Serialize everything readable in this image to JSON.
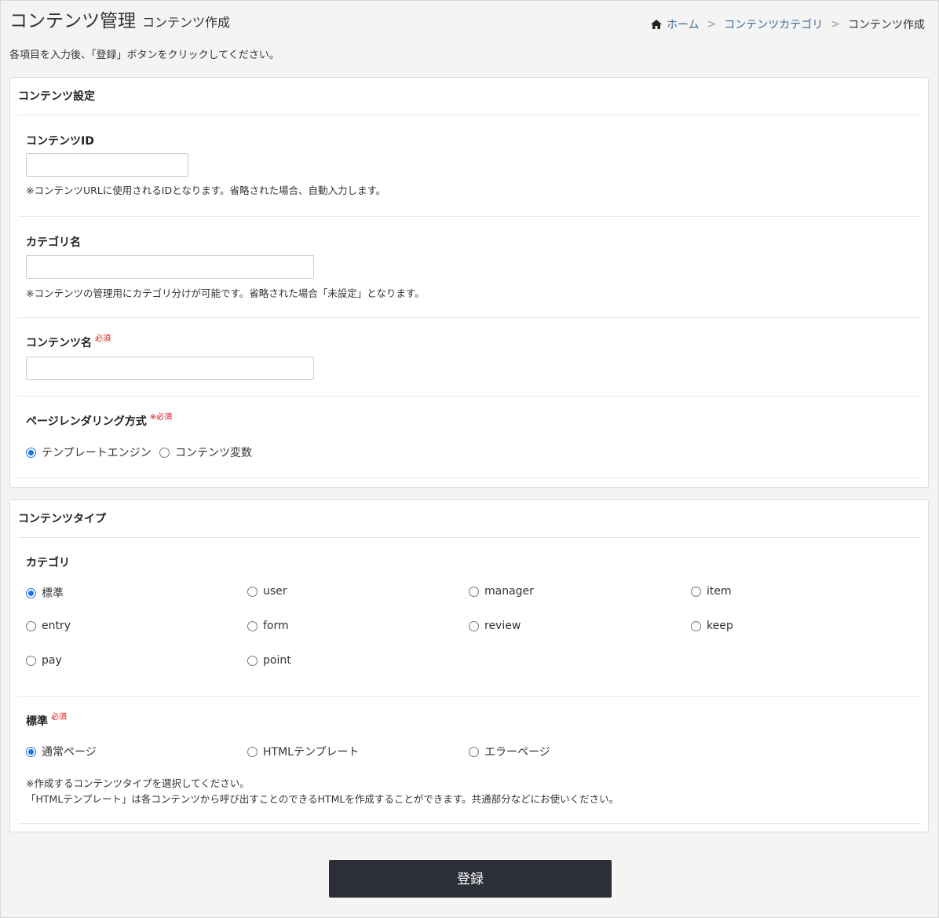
{
  "header": {
    "title": "コンテンツ管理",
    "subtitle": "コンテンツ作成"
  },
  "breadcrumb": {
    "home": "ホーム",
    "sep": ">",
    "category": "コンテンツカテゴリ",
    "current": "コンテンツ作成"
  },
  "intro": "各項目を入力後、「登録」ボタンをクリックしてください。",
  "settings": {
    "heading": "コンテンツ設定",
    "content_id": {
      "label": "コンテンツID",
      "value": "",
      "help": "※コンテンツURLに使用されるIDとなります。省略された場合、自動入力します。"
    },
    "category_name": {
      "label": "カテゴリ名",
      "value": "",
      "help": "※コンテンツの管理用にカテゴリ分けが可能です。省略された場合「未設定」となります。"
    },
    "content_name": {
      "label": "コンテンツ名",
      "required": "必須",
      "value": ""
    },
    "rendering": {
      "label": "ページレンダリング方式",
      "required": "※必須",
      "options": [
        "テンプレートエンジン",
        "コンテンツ変数"
      ],
      "selected": "テンプレートエンジン"
    }
  },
  "type": {
    "heading": "コンテンツタイプ",
    "category": {
      "label": "カテゴリ",
      "options": [
        "標準",
        "user",
        "manager",
        "item",
        "entry",
        "form",
        "review",
        "keep",
        "pay",
        "point"
      ],
      "selected": "標準"
    },
    "standard": {
      "label": "標準",
      "required": "必須",
      "options": [
        "通常ページ",
        "HTMLテンプレート",
        "エラーページ"
      ],
      "selected": "通常ページ",
      "help1": "※作成するコンテンツタイプを選択してください。",
      "help2": "「HTMLテンプレート」は各コンテンツから呼び出すことのできるHTMLを作成することができます。共通部分などにお使いください。"
    }
  },
  "submit_label": "登録",
  "colors": {
    "link": "#3c6a9a",
    "required": "#dd1111",
    "radio_selected": "#1a73e8",
    "submit_bg": "#2d2f38"
  }
}
